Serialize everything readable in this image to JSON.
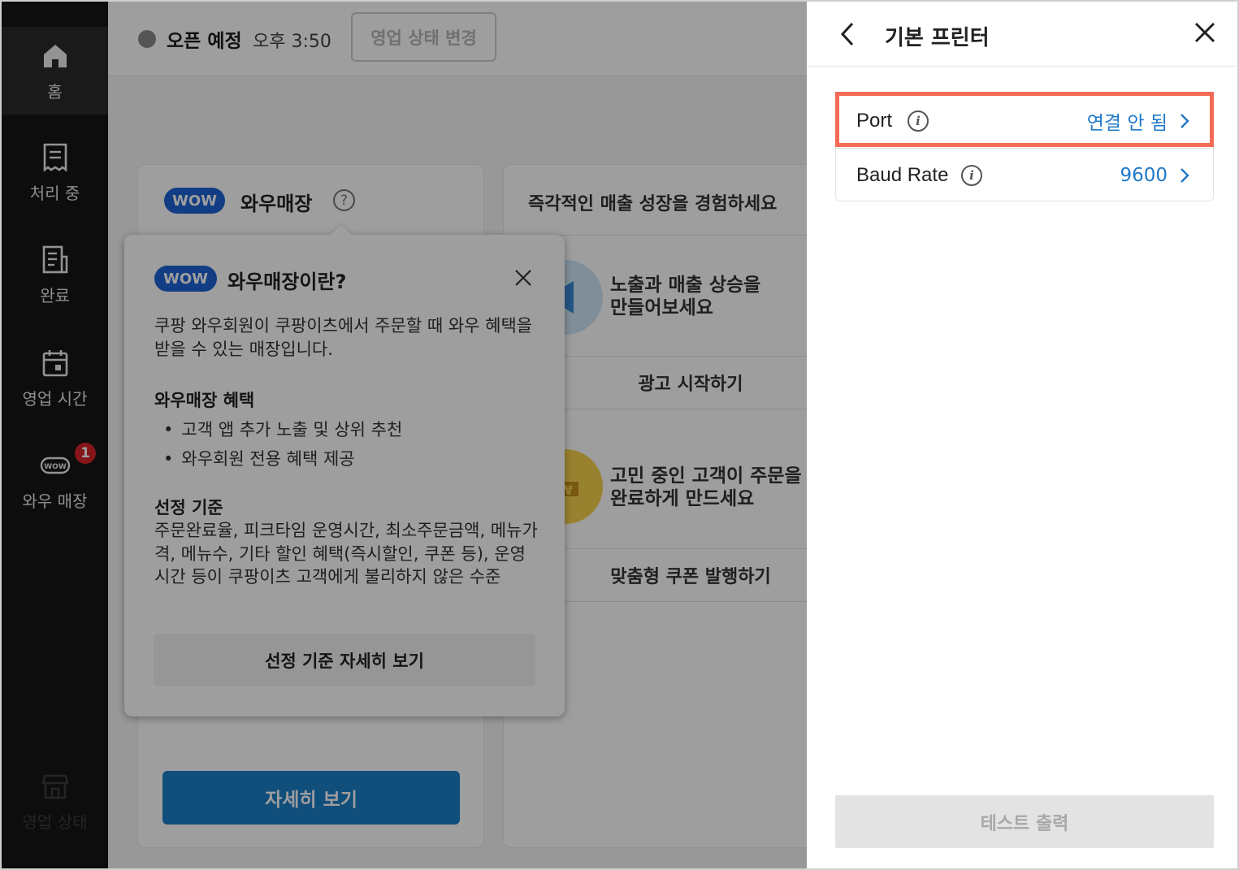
{
  "sidebar": {
    "items": [
      {
        "label": "홈",
        "icon": "home-icon"
      },
      {
        "label": "처리 중",
        "icon": "receipt-icon"
      },
      {
        "label": "완료",
        "icon": "document-list-icon"
      },
      {
        "label": "영업 시간",
        "icon": "calendar-icon"
      },
      {
        "label": "와우 매장",
        "icon": "wow-icon",
        "badge": "1"
      },
      {
        "label": "영업 상태",
        "icon": "store-icon"
      }
    ]
  },
  "topbar": {
    "status_label": "오픈 예정",
    "status_time": "오후 3:50",
    "change_button": "영업 상태 변경"
  },
  "wow_card": {
    "badge": "WOW",
    "title": "와우매장",
    "detail_button": "자세히 보기"
  },
  "growth_card": {
    "heading": "즉각적인 매출 성장을 경험하세요",
    "promos": [
      {
        "line1": "노출과 매출 상승을",
        "line2": "만들어보세요",
        "button": "광고 시작하기"
      },
      {
        "line1": "고민 중인 고객이 주문을",
        "line2": "완료하게 만드세요",
        "button": "맞춤형 쿠폰 발행하기"
      }
    ]
  },
  "popover": {
    "badge": "WOW",
    "title": "와우매장이란?",
    "description": "쿠팡 와우회원이 쿠팡이츠에서 주문할 때 와우 혜택을 받을 수 있는 매장입니다.",
    "benefits_heading": "와우매장 혜택",
    "benefits": [
      "고객 앱 추가 노출 및 상위 추천",
      "와우회원 전용 혜택 제공"
    ],
    "criteria_heading": "선정 기준",
    "criteria_text": "주문완료율, 피크타임 운영시간, 최소주문금액, 메뉴가격, 메뉴수, 기타 할인 혜택(즉시할인, 쿠폰 등), 운영시간 등이 쿠팡이츠 고객에게 불리하지 않은 수준",
    "criteria_button": "선정 기준 자세히 보기"
  },
  "panel": {
    "title": "기본 프린터",
    "settings": [
      {
        "label": "Port",
        "value": "연결 안 됨"
      },
      {
        "label": "Baud Rate",
        "value": "9600"
      }
    ],
    "test_button": "테스트 출력"
  },
  "colors": {
    "accent_blue": "#1f78c8",
    "wow_blue": "#1e63d6",
    "highlight": "#f36b57",
    "badge_red": "#d8232a"
  }
}
